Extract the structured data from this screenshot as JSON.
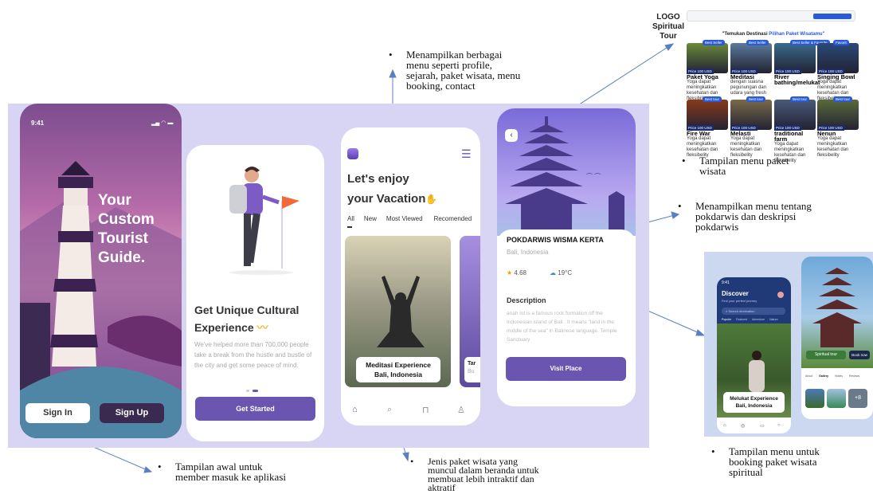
{
  "notes": {
    "top": "Menampilkan berbagai menu seperti profile, sejarah, paket wisata, menu booking, contact",
    "paket": "Tampilan menu paket wisata",
    "pokdarwis": "Menampilkan menu tentang pokdarwis dan deskripsi pokdarwis",
    "signin": "Tampilan awal untuk member masuk ke aplikasi",
    "jenis": "Jenis paket wisata yang muncul dalam beranda untuk membuat lebih intraktif dan aktratif",
    "booking": "Tampilan menu untuk booking paket wisata spiritual"
  },
  "logo": {
    "line1": "LOGO",
    "line2": "Spiritual Tour"
  },
  "web": {
    "heading_prefix": "\"Temukan Destinasi ",
    "heading_highlight": "Pilihan Paket Wisatamu\"",
    "tours": [
      {
        "badge": "Best Seller",
        "price": "Price 100 USD",
        "name": "Paket Yoga",
        "desc": "Yoga dapat meningkatkan kesehatan dan fleksibility"
      },
      {
        "badge": "Best Seller",
        "price": "Price 100 USD",
        "name": "Meditasi",
        "desc": "dengan suasna pegunungan dan udara yang fresh"
      },
      {
        "badge": "Best Seller & Favorite",
        "price": "Price 100 USD",
        "name": "River bathing/melukat",
        "desc": ""
      },
      {
        "badge": "Favorit",
        "price": "Price 100 USD",
        "name": "Singing Bowl",
        "desc": "Yoga dapat meningkatkan kesehatan dan fleksibelity"
      },
      {
        "badge": "Best tour",
        "price": "Price 100 USD",
        "name": "Fire War",
        "desc": "Yoga dapat meningkatkan kesehatan dan fleksibelity"
      },
      {
        "badge": "Best tour",
        "price": "Price 100 USD",
        "name": "Melasti",
        "desc": "Yoga dapat meningkatkan kesehatan dan fleksibelity"
      },
      {
        "badge": "Best tour",
        "price": "Price 100 USD",
        "name": "traditional farm",
        "desc": "Yoga dapat meningkatkan kesehatan dan fleksibelity"
      },
      {
        "badge": "Best tour",
        "price": "Price 100 USD",
        "name": "Nenun",
        "desc": "Yoga dapat meningkatkan kesehatan dan fleksibelity"
      }
    ]
  },
  "screen1": {
    "time": "9:41",
    "title1": "Your",
    "title2": "Custom",
    "title3": "Tourist",
    "title4": "Guide.",
    "signin": "Sign In",
    "signup": "Sign Up"
  },
  "screen2": {
    "title1": "Get Unique Cultural",
    "title2": "Experience",
    "body": "We've helped more than 700,000 people take a break from the hustle and bustle of the city and get some peace of mind.",
    "cta": "Get Started"
  },
  "screen3": {
    "title1": "Let's enjoy",
    "title2": "your Vacation",
    "tabs": [
      "All",
      "New",
      "Most Viewed",
      "Recomended"
    ],
    "card_line1": "Meditasi Experience",
    "card_line2": "Bali, Indonesia",
    "card2": "Tar",
    "card2_sub": "Bu"
  },
  "screen4": {
    "name": "POKDARWIS WISMA KERTA",
    "location": "Bali, Indonesia",
    "rating": "4.68",
    "temp": "19°C",
    "desc_title": "Description",
    "desc": "anah lot is a famous rock formation off the Indonesian island of Bali . It means \"land in the middle of the sea\" in Balinese language. Temple Sanctuary",
    "cta": "Visit Place"
  },
  "booking": {
    "time": "9:41",
    "title": "Discover",
    "subtitle": "Find your perfect journey",
    "search": "Search destination",
    "tabs": [
      "Populer",
      "Featured",
      "Adventure",
      "Nature"
    ],
    "card_line1": "Melukat Experience",
    "card_line2": "Bali, Indonesia",
    "chip": "Spiritual tour",
    "book": "Book now",
    "dtabs": [
      "About",
      "Gallery",
      "Hotels",
      "Reviews"
    ],
    "more": "+8"
  }
}
